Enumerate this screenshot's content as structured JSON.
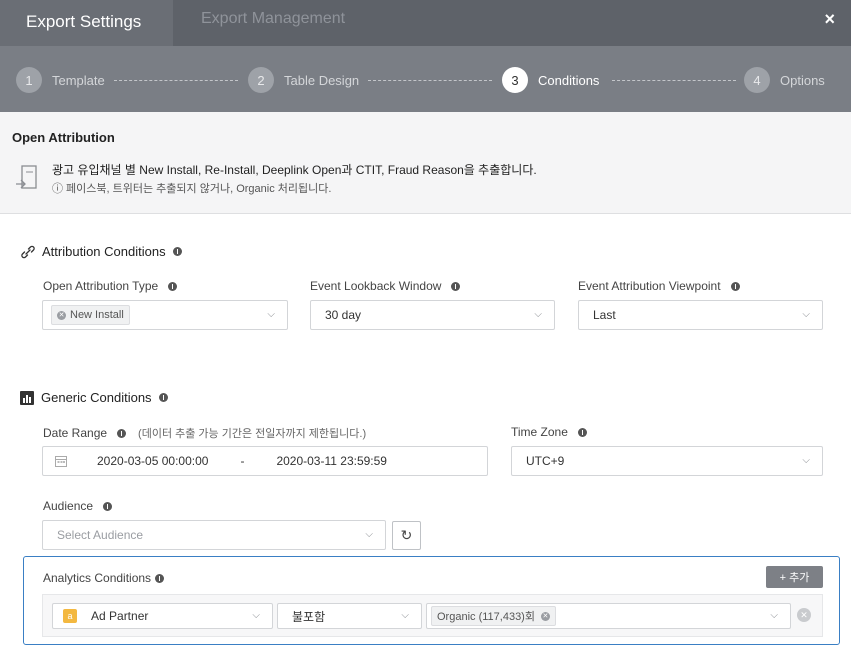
{
  "header": {
    "tabs": [
      {
        "label": "Export Settings",
        "active": true
      },
      {
        "label": "Export Management",
        "active": false
      }
    ],
    "close_icon": "×"
  },
  "stepper": {
    "steps": [
      {
        "num": "1",
        "label": "Template"
      },
      {
        "num": "2",
        "label": "Table Design"
      },
      {
        "num": "3",
        "label": "Conditions",
        "active": true
      },
      {
        "num": "4",
        "label": "Options"
      }
    ]
  },
  "description": {
    "title": "Open Attribution",
    "main": "광고 유입채널 별 New Install, Re-Install, Deeplink Open과 CTIT, Fraud Reason을 추출합니다.",
    "note": "ⓘ 페이스북, 트위터는 추출되지 않거나, Organic 처리됩니다."
  },
  "attribution": {
    "title": "Attribution Conditions",
    "open_type_label": "Open Attribution Type",
    "open_type_tag": "New Install",
    "lookback_label": "Event Lookback Window",
    "lookback_value": "30 day",
    "viewpoint_label": "Event Attribution Viewpoint",
    "viewpoint_value": "Last"
  },
  "generic": {
    "title": "Generic Conditions",
    "date_range_label": "Date Range",
    "date_range_hint": "(데이터 추출 가능 기간은 전일자까지 제한됩니다.)",
    "date_start": "2020-03-05 00:00:00",
    "date_sep": "-",
    "date_end": "2020-03-11 23:59:59",
    "timezone_label": "Time Zone",
    "timezone_value": "UTC+9",
    "audience_label": "Audience",
    "audience_placeholder": "Select Audience"
  },
  "analytics": {
    "title": "Analytics Conditions",
    "add_label": "+ 추가",
    "row": {
      "field_badge": "a",
      "field": "Ad Partner",
      "operator": "불포함",
      "value_tag": "Organic (117,433)회"
    }
  },
  "colors": {
    "header_bg": "#5e6269",
    "stepper_bg": "#7a7e85",
    "highlight_border": "#3a7fc4",
    "badge_accent": "#f3b840"
  }
}
